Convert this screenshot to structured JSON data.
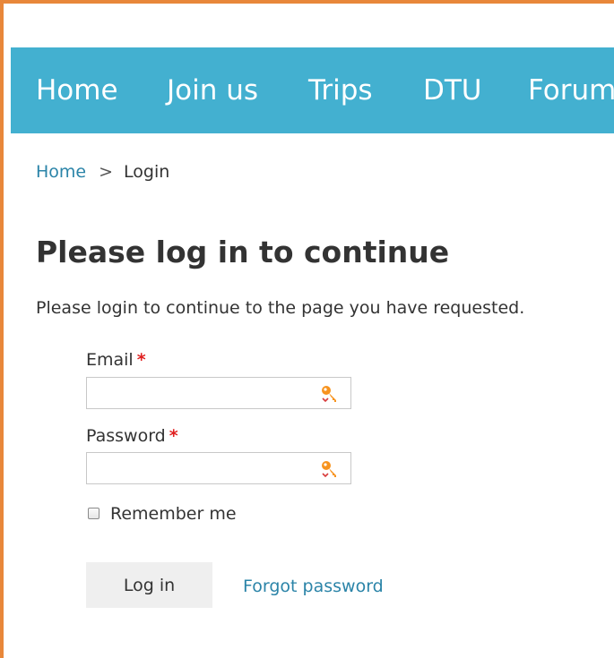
{
  "nav": {
    "items": [
      {
        "label": "Home"
      },
      {
        "label": "Join us"
      },
      {
        "label": "Trips"
      },
      {
        "label": "DTU"
      },
      {
        "label": "Forum"
      }
    ]
  },
  "breadcrumb": {
    "home": "Home",
    "separator": ">",
    "current": "Login"
  },
  "page": {
    "title": "Please log in to continue",
    "intro": "Please login to continue to the page you have requested."
  },
  "form": {
    "email": {
      "label": "Email",
      "required_mark": "*",
      "value": "",
      "icon": "key-icon"
    },
    "password": {
      "label": "Password",
      "required_mark": "*",
      "value": "",
      "icon": "key-icon"
    },
    "remember": {
      "label": "Remember me",
      "checked": false
    },
    "submit_label": "Log in",
    "forgot_label": "Forgot password"
  },
  "colors": {
    "nav_background": "#43b0d0",
    "link": "#2b84a8",
    "required": "#e02020",
    "frame_accent": "#e8873a"
  }
}
